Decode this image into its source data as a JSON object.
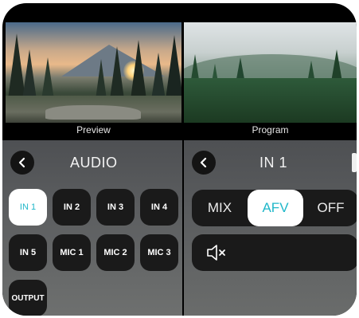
{
  "monitors": {
    "preview_label": "Preview",
    "program_label": "Program"
  },
  "audio_panel": {
    "title": "AUDIO",
    "back_icon": "chevron-left-icon",
    "selected": "IN 1",
    "channels": [
      "IN 1",
      "IN 2",
      "IN 3",
      "IN 4",
      "IN 5",
      "MIC 1",
      "MIC 2",
      "MIC 3",
      "OUTPUT"
    ]
  },
  "channel_panel": {
    "title": "IN 1",
    "back_icon": "chevron-left-icon",
    "modes": [
      "MIX",
      "AFV",
      "OFF"
    ],
    "selected_mode": "AFV",
    "mute_icon": "speaker-mute-icon"
  },
  "colors": {
    "accent": "#1fb7c9",
    "button_bg": "#1a1a1a",
    "active_bg": "#ffffff"
  }
}
